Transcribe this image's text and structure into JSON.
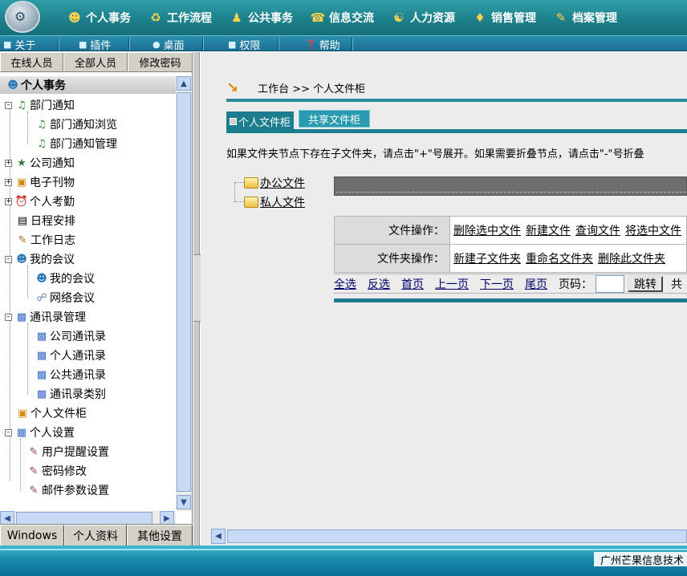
{
  "topnav": {
    "items": [
      {
        "label": "个人事务",
        "icon": "person-icon"
      },
      {
        "label": "工作流程",
        "icon": "workflow-icon"
      },
      {
        "label": "公共事务",
        "icon": "people-icon"
      },
      {
        "label": "信息交流",
        "icon": "chat-icon"
      },
      {
        "label": "人力资源",
        "icon": "hr-icon"
      },
      {
        "label": "销售管理",
        "icon": "sales-icon"
      },
      {
        "label": "档案管理",
        "icon": "archive-icon"
      }
    ]
  },
  "subnav": {
    "items": [
      {
        "label": "关于"
      },
      {
        "label": "插件"
      },
      {
        "label": "桌面"
      },
      {
        "label": "权限"
      },
      {
        "label": "帮助"
      }
    ]
  },
  "left": {
    "tabs": [
      "在线人员",
      "全部人员",
      "修改密码"
    ],
    "tree_header": "个人事务",
    "tree": [
      {
        "label": "部门通知"
      },
      {
        "label": "部门通知浏览"
      },
      {
        "label": "部门通知管理"
      },
      {
        "label": "公司通知"
      },
      {
        "label": "电子刊物"
      },
      {
        "label": "个人考勤"
      },
      {
        "label": "日程安排"
      },
      {
        "label": "工作日志"
      },
      {
        "label": "我的会议"
      },
      {
        "label": "我的会议"
      },
      {
        "label": "网络会议"
      },
      {
        "label": "通讯录管理"
      },
      {
        "label": "公司通讯录"
      },
      {
        "label": "个人通讯录"
      },
      {
        "label": "公共通讯录"
      },
      {
        "label": "通讯录类别"
      },
      {
        "label": "个人文件柜"
      },
      {
        "label": "个人设置"
      },
      {
        "label": "用户提醒设置"
      },
      {
        "label": "密码修改"
      },
      {
        "label": "邮件参数设置"
      }
    ],
    "bottom_tabs": [
      "Windows",
      "个人资料",
      "其他设置"
    ]
  },
  "main": {
    "breadcrumb": "工作台 >> 个人文件柜",
    "tab_active": "个人文件柜",
    "tab_other": "共享文件柜",
    "hint": "如果文件夹节点下存在子文件夹，请点击\"+\"号展开。如果需要折叠节点，请点击\"-\"号折叠",
    "folders": [
      "办公文件",
      "私人文件"
    ],
    "file_ops_label": "文件操作：",
    "file_ops": [
      "删除选中文件",
      "新建文件",
      "查询文件",
      "将选中文件"
    ],
    "folder_ops_label": "文件夹操作：",
    "folder_ops": [
      "新建子文件夹",
      "重命名文件夹",
      "删除此文件夹"
    ],
    "pager": {
      "links": [
        "全选",
        "反选",
        "首页",
        "上一页",
        "下一页",
        "尾页"
      ],
      "page_label": "页码：",
      "go_button": "跳转",
      "tail": "共"
    }
  },
  "footer": {
    "company": "广州芒果信息技术"
  }
}
